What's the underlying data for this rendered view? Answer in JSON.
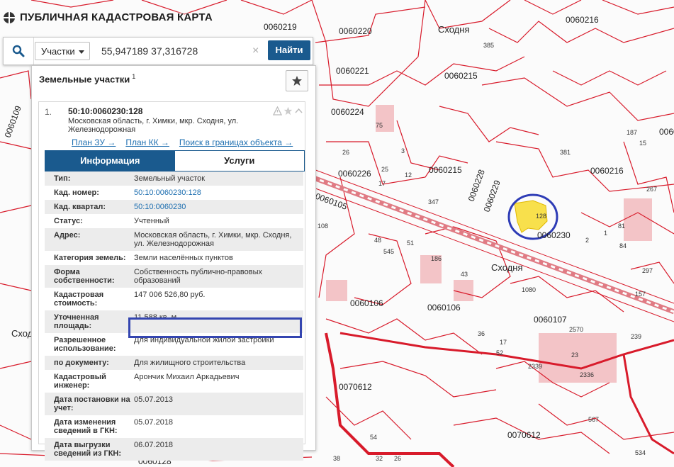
{
  "app": {
    "title": "ПУБЛИЧНАЯ КАДАСТРОВАЯ КАРТА"
  },
  "search": {
    "type_label": "Участки",
    "query": "55,947189 37,316728",
    "clear_symbol": "×",
    "find_label": "Найти"
  },
  "panel": {
    "title": "Земельные участки",
    "count": "1",
    "item": {
      "index": "1.",
      "number": "50:10:0060230:128",
      "address": "Московская область, г. Химки, мкр. Сходня, ул. Железнодорожная",
      "links": [
        "План ЗУ →",
        "План КК →",
        "Поиск в границах объекта →"
      ]
    },
    "tabs": [
      "Информация",
      "Услуги"
    ],
    "rows": [
      {
        "k": "Тип:",
        "v": "Земельный участок"
      },
      {
        "k": "Кад. номер:",
        "v": "50:10:0060230:128"
      },
      {
        "k": "Кад. квартал:",
        "v": "50:10:0060230"
      },
      {
        "k": "Статус:",
        "v": "Учтенный"
      },
      {
        "k": "Адрес:",
        "v": "Московская область, г. Химки, мкр. Сходня, ул. Железнодорожная"
      },
      {
        "k": "Категория земель:",
        "v": "Земли населённых пунктов"
      },
      {
        "k": "Форма собственности:",
        "v": "Собственность публично-правовых образований"
      },
      {
        "k": "Кадастровая стоимость:",
        "v": "147 006 526,80 руб."
      },
      {
        "k": "Уточненная площадь:",
        "v": "11 588 кв. м"
      },
      {
        "k": "Разрешенное использование:",
        "v": "Для индивидуальной жилой застройки"
      },
      {
        "k": "по документу:",
        "v": "Для жилищного строительства"
      },
      {
        "k": "Кадастровый инженер:",
        "v": "Арончик Михаил Аркадьевич"
      },
      {
        "k": "Дата постановки на учет:",
        "v": "05.07.2013"
      },
      {
        "k": "Дата изменения сведений в ГКН:",
        "v": "05.07.2018"
      },
      {
        "k": "Дата выгрузки сведений из ГКН:",
        "v": "06.07.2018"
      }
    ]
  },
  "map": {
    "place_labels": [
      "Сходня",
      "Сходня",
      "Сходня"
    ],
    "quarter_labels": [
      "0060219",
      "0060220",
      "0060221",
      "0060224",
      "0060215",
      "0060216",
      "0060226",
      "0060215",
      "0060228",
      "0060229",
      "0060230",
      "0060105",
      "0060106",
      "0060106",
      "0060107",
      "0070612",
      "0070612",
      "0060128",
      "0060216",
      "0060109",
      "0060109"
    ],
    "parcel_numbers": [
      "385",
      "75",
      "26",
      "25",
      "3",
      "17",
      "12",
      "347",
      "381",
      "128",
      "187",
      "267",
      "84",
      "2",
      "1",
      "48",
      "545",
      "51",
      "186",
      "43",
      "1080",
      "17",
      "36",
      "52",
      "2570",
      "239",
      "23",
      "2336",
      "2339",
      "54",
      "567",
      "534",
      "38",
      "32",
      "26",
      "108",
      "297",
      "157",
      "15",
      "81"
    ]
  }
}
